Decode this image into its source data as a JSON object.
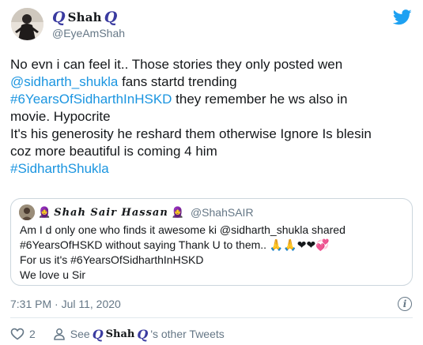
{
  "author": {
    "display_name": "Shah",
    "name_decoration": "Q",
    "handle": "@EyeAmShah"
  },
  "tweet": {
    "lines": [
      [
        {
          "t": "No evn i can feel it.. Those stories they only posted wen",
          "link": false
        }
      ],
      [
        {
          "t": "@sidharth_shukla",
          "link": true
        },
        {
          "t": " fans startd trending",
          "link": false
        }
      ],
      [
        {
          "t": "#6YearsOfSidharthInHSKD",
          "link": true
        },
        {
          "t": "  they remember he ws also in",
          "link": false
        }
      ],
      [
        {
          "t": "movie. Hypocrite",
          "link": false
        }
      ],
      [
        {
          "t": "It's his generosity he reshard them otherwise Ignore Is blesin",
          "link": false
        }
      ],
      [
        {
          "t": "coz more beautiful is coming 4 him",
          "link": false
        }
      ],
      [
        {
          "t": "#SidharthShukla",
          "link": true
        }
      ]
    ]
  },
  "quoted": {
    "display_name": "Shah Sair Hassan",
    "handle": "@ShahSAIR",
    "lines": [
      "Am I d only one who finds it awesome ki @sidharth_shukla shared",
      "#6YearsOfHSKD without saying Thank U to them.. 🙏🙏❤❤💞",
      "For us it's #6YearsOfSidharthInHSKD",
      "We love u Sir"
    ]
  },
  "timestamp": "7:31 PM · Jul 11, 2020",
  "info_label": "i",
  "footer": {
    "like_count": "2",
    "see_prefix": "See",
    "see_name": "Shah",
    "see_suffix": "'s other Tweets"
  },
  "colors": {
    "link": "#1b95e0",
    "muted": "#657786",
    "twitter_blue": "#1da1f2",
    "heart_red": "#e0245e"
  },
  "icons": [
    "twitter-bird-icon",
    "info-icon",
    "heart-icon",
    "person-icon"
  ]
}
